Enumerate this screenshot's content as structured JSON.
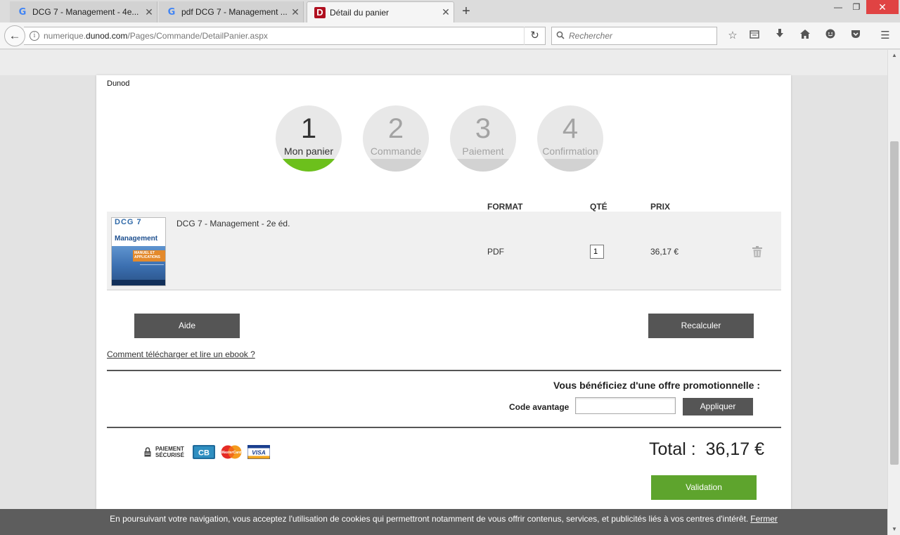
{
  "browser": {
    "tabs": [
      {
        "title": "DCG 7 - Management - 4e...",
        "icon": "google-icon",
        "active": false
      },
      {
        "title": "pdf DCG 7 - Management ...",
        "icon": "google-icon",
        "active": false
      },
      {
        "title": "Détail du panier",
        "icon": "dunod-favicon",
        "active": true
      }
    ],
    "url_prefix": "numerique.",
    "url_domain": "dunod.com",
    "url_path": "/Pages/Commande/DetailPanier.aspx",
    "search_placeholder": "Rechercher"
  },
  "site": {
    "name": "Dunod"
  },
  "steps": [
    {
      "number": "1",
      "label": "Mon panier",
      "active": true
    },
    {
      "number": "2",
      "label": "Commande",
      "active": false
    },
    {
      "number": "3",
      "label": "Paiement",
      "active": false
    },
    {
      "number": "4",
      "label": "Confirmation",
      "active": false
    }
  ],
  "cart": {
    "headers": {
      "format": "FORMAT",
      "qty": "QTÉ",
      "price": "PRIX"
    },
    "items": [
      {
        "title": "DCG 7 - Management - 2e éd.",
        "format": "PDF",
        "qty": "1",
        "price": "36,17 €",
        "cover_series": "DCG 7",
        "cover_title": "Management",
        "cover_band": "MANUEL ET APPLICATIONS"
      }
    ]
  },
  "actions": {
    "help": "Aide",
    "recalc": "Recalculer",
    "ebook_link": "Comment télécharger et lire un ebook ?"
  },
  "promo": {
    "title": "Vous bénéficiez d'une offre promotionnelle :",
    "code_label": "Code avantage",
    "code_value": "",
    "apply": "Appliquer"
  },
  "payment": {
    "secure_line1": "PAIEMENT",
    "secure_line2": "SÉCURISÉ",
    "cards": [
      "CB",
      "MasterCard",
      "VISA"
    ]
  },
  "total": {
    "label": "Total :",
    "amount": "36,17 €"
  },
  "validate": "Validation",
  "cookie": {
    "text": "En poursuivant votre navigation, vous acceptez l'utilisation de cookies qui permettront notamment de vous offrir contenus, services, et publicités liés à vos centres d'intérêt.",
    "close": "Fermer"
  },
  "colors": {
    "accent_green": "#6cc01c",
    "validate_green": "#5ea42d",
    "dark_button": "#555555"
  }
}
